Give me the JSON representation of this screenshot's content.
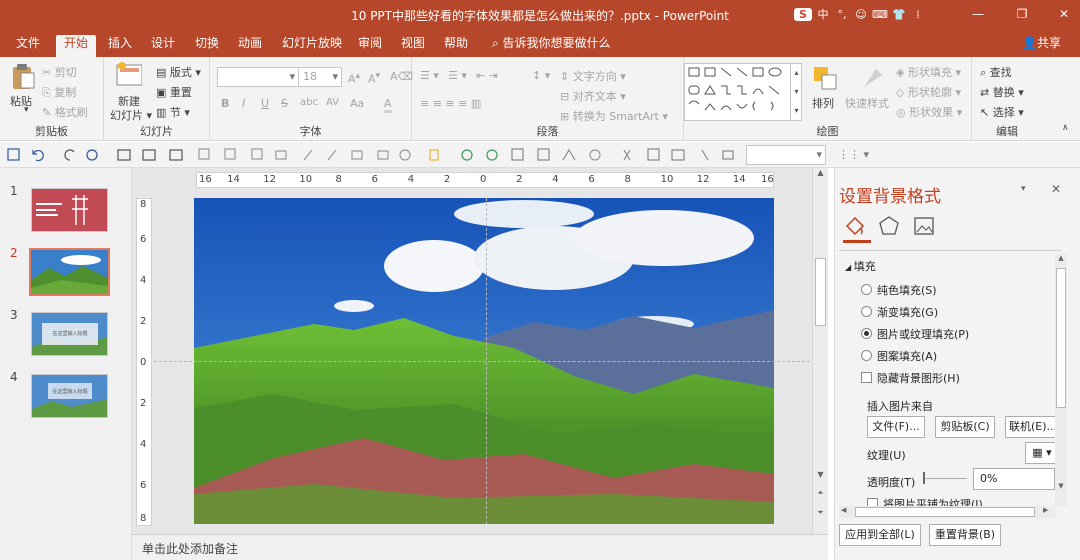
{
  "titlebar": {
    "title": "10 PPT中那些好看的字体效果都是怎么做出来的？.pptx - PowerPoint",
    "ime": [
      "S",
      "中",
      "°,",
      "☺",
      "⌨",
      "👕",
      "⁞"
    ],
    "minimize": "—",
    "restore": "❐",
    "close": "✕"
  },
  "tabs": [
    "文件",
    "开始",
    "插入",
    "设计",
    "切换",
    "动画",
    "幻灯片放映",
    "审阅",
    "视图",
    "帮助"
  ],
  "tellme": "告诉我你想要做什么",
  "share": "共享",
  "ribbon": {
    "clipboard": {
      "label": "剪贴板",
      "paste": "粘贴",
      "cut": "剪切",
      "copy": "复制",
      "format_painter": "格式刷"
    },
    "slides": {
      "label": "幻灯片",
      "new_slide": "新建",
      "new_slide2": "幻灯片",
      "layout": "版式",
      "reset": "重置",
      "section": "节"
    },
    "font": {
      "label": "字体",
      "size": "18",
      "bold": "B",
      "italic": "I",
      "underline": "U",
      "strike": "S",
      "shadow": "abc",
      "spacing": "AV",
      "case": "Aa",
      "color": "A"
    },
    "paragraph": {
      "label": "段落",
      "text_direction": "文字方向",
      "align_text": "对齐文本",
      "smartart": "转换为 SmartArt"
    },
    "drawing": {
      "label": "绘图",
      "arrange": "排列",
      "quick_styles": "快速样式",
      "fill": "形状填充",
      "outline": "形状轮廓",
      "effects": "形状效果"
    },
    "editing": {
      "label": "编辑",
      "find": "查找",
      "replace": "替换",
      "select": "选择"
    }
  },
  "thumbnails": [
    {
      "num": "1"
    },
    {
      "num": "2"
    },
    {
      "num": "3",
      "caption": "在这里输入标题"
    },
    {
      "num": "4",
      "caption": "在这里输入标题"
    }
  ],
  "ruler_h": [
    "16",
    "14",
    "12",
    "10",
    "8",
    "6",
    "4",
    "2",
    "0",
    "2",
    "4",
    "6",
    "8",
    "10",
    "12",
    "14",
    "16"
  ],
  "ruler_v": [
    "8",
    "6",
    "4",
    "2",
    "0",
    "2",
    "4",
    "6",
    "8"
  ],
  "notes": "单击此处添加备注",
  "pane": {
    "title": "设置背景格式",
    "section": "填充",
    "options": [
      {
        "label": "纯色填充(S)",
        "checked": false
      },
      {
        "label": "渐变填充(G)",
        "checked": false
      },
      {
        "label": "图片或纹理填充(P)",
        "checked": true
      },
      {
        "label": "图案填充(A)",
        "checked": false
      }
    ],
    "hide_bg": "隐藏背景图形(H)",
    "insert_from": "插入图片来自",
    "file_btn": "文件(F)...",
    "clipboard_btn": "剪贴板(C)",
    "online_btn": "联机(E)...",
    "texture": "纹理(U)",
    "transparency": "透明度(T)",
    "transparency_value": "0%",
    "cut_text": "将图片平铺为纹理(I)",
    "apply_all": "应用到全部(L)",
    "reset_bg": "重置背景(B)"
  },
  "colors": {
    "accent": "#b7472a",
    "ribbon": "#f3f3f3",
    "pane_title": "#c43e1c"
  }
}
